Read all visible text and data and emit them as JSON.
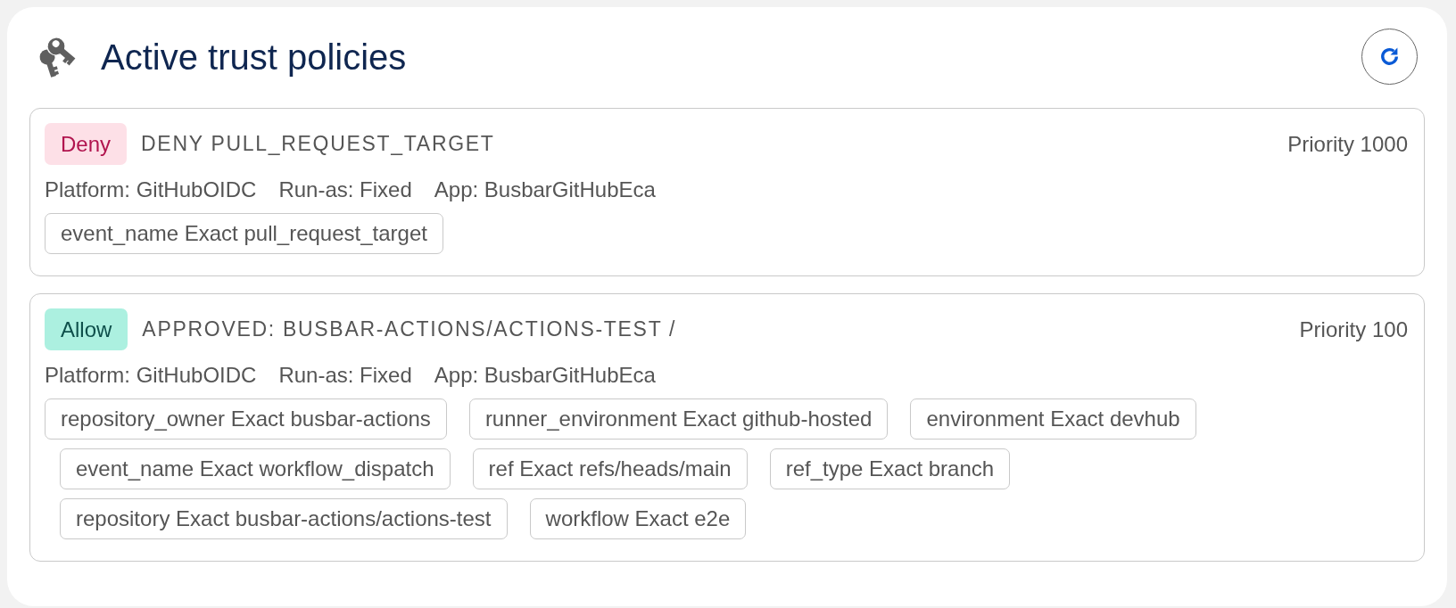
{
  "header": {
    "title": "Active trust policies"
  },
  "policies": [
    {
      "kind": "deny",
      "effect": "Deny",
      "name": "DENY PULL_REQUEST_TARGET",
      "priority": "Priority 1000",
      "details": [
        "Platform: GitHubOIDC",
        "Run-as: Fixed",
        "App: BusbarGitHubEca"
      ],
      "conditions": [
        "event_name Exact pull_request_target"
      ]
    },
    {
      "kind": "allow",
      "effect": "Allow",
      "name": "APPROVED: BUSBAR-ACTIONS/ACTIONS-TEST /",
      "priority": "Priority 100",
      "details": [
        "Platform: GitHubOIDC",
        "Run-as: Fixed",
        "App: BusbarGitHubEca"
      ],
      "conditions": [
        "repository_owner Exact busbar-actions",
        "runner_environment Exact github-hosted",
        "environment Exact devhub",
        "event_name Exact workflow_dispatch",
        "ref Exact refs/heads/main",
        "ref_type Exact branch",
        "repository Exact busbar-actions/actions-test",
        "workflow Exact e2e"
      ]
    }
  ]
}
